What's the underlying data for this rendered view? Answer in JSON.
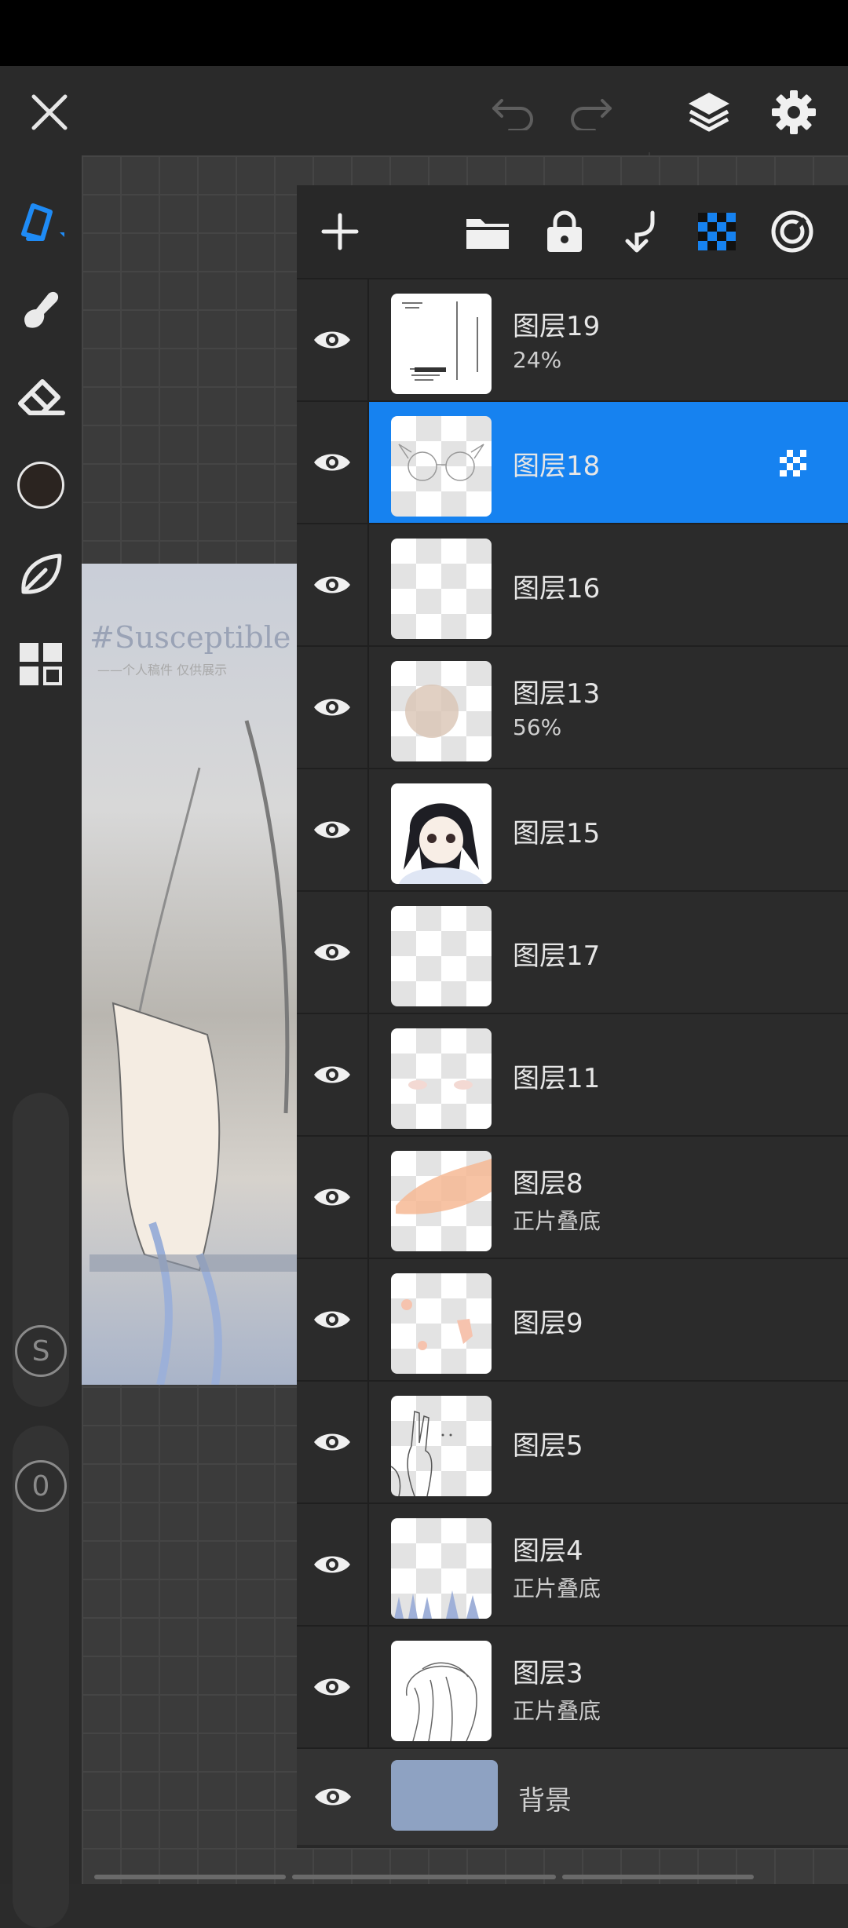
{
  "top_bar": {
    "icons": [
      "close-icon",
      "undo-icon",
      "redo-icon",
      "layers-icon",
      "settings-icon"
    ]
  },
  "left_toolbar": {
    "tools": [
      "pen-icon",
      "smudge-icon",
      "eraser-icon",
      "color-swatch",
      "leaf-icon",
      "grid-icon"
    ],
    "color": "#2b2420",
    "size_label": "S",
    "opacity_label": "0"
  },
  "artwork": {
    "title": "#Susceptible",
    "subtitle": "——个人稿件 仅供展示"
  },
  "layers_panel": {
    "toolbar_icons": [
      "add-icon",
      "folder-icon",
      "lock-icon",
      "merge-down-icon",
      "alpha-lock-icon",
      "blend-icon"
    ],
    "accent": "#1682f0",
    "layers": [
      {
        "name": "图层19",
        "sub": "24%"
      },
      {
        "name": "图层18",
        "sub": "",
        "selected": true
      },
      {
        "name": "图层16",
        "sub": ""
      },
      {
        "name": "图层13",
        "sub": "56%"
      },
      {
        "name": "图层15",
        "sub": ""
      },
      {
        "name": "图层17",
        "sub": ""
      },
      {
        "name": "图层11",
        "sub": ""
      },
      {
        "name": "图层8",
        "sub": "正片叠底"
      },
      {
        "name": "图层9",
        "sub": ""
      },
      {
        "name": "图层5",
        "sub": ""
      },
      {
        "name": "图层4",
        "sub": "正片叠底"
      },
      {
        "name": "图层3",
        "sub": "正片叠底"
      }
    ],
    "background_label": "背景",
    "background_color": "#8ea2c2"
  }
}
